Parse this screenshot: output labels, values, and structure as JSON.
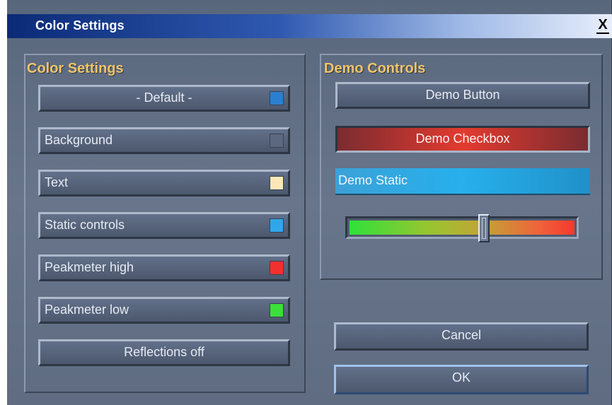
{
  "window": {
    "title": "Color Settings",
    "close_label": "X"
  },
  "color_settings": {
    "heading": "Color Settings",
    "preset": {
      "label": "- Default -",
      "swatch_color": "#2a7fd0"
    },
    "items": [
      {
        "label": "Background",
        "swatch_color": "#5c6880"
      },
      {
        "label": "Text",
        "swatch_color": "#ffe8b8"
      },
      {
        "label": "Static controls",
        "swatch_color": "#2fa7ea"
      },
      {
        "label": "Peakmeter high",
        "swatch_color": "#f33030"
      },
      {
        "label": "Peakmeter low",
        "swatch_color": "#3be03b"
      }
    ],
    "reflections_label": "Reflections off"
  },
  "demo_controls": {
    "heading": "Demo Controls",
    "button_label": "Demo Button",
    "checkbox_label": "Demo Checkbox",
    "static_label": "Demo Static",
    "slider_value_fraction": 0.6
  },
  "footer": {
    "cancel_label": "Cancel",
    "ok_label": "OK"
  },
  "colors": {
    "heading": "#f2c56a",
    "titlebar_start": "#0b2a76",
    "window_bg": "#627089"
  }
}
